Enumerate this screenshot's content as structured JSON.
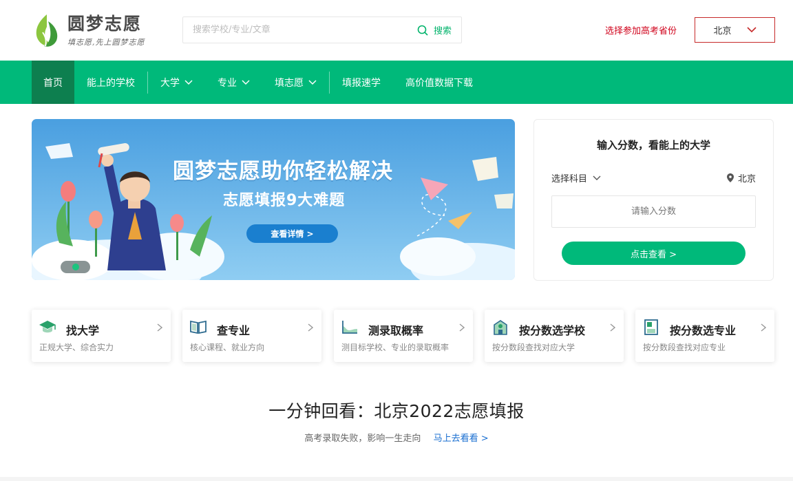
{
  "brand": {
    "name": "圆梦志愿",
    "slogan": "填志愿,先上圆梦志愿"
  },
  "search": {
    "placeholder": "搜索学校/专业/文章",
    "button_label": "搜索"
  },
  "province": {
    "prompt": "选择参加高考省份",
    "selected": "北京"
  },
  "nav": {
    "items": [
      {
        "label": "首页"
      },
      {
        "label": "能上的学校"
      },
      {
        "label": "大学"
      },
      {
        "label": "专业"
      },
      {
        "label": "填志愿"
      },
      {
        "label": "填报速学"
      },
      {
        "label": "高价值数据下载"
      }
    ]
  },
  "banner": {
    "title": "圆梦志愿助你轻松解决",
    "subtitle": "志愿填报9大难题",
    "button_label": "查看详情 >"
  },
  "score_box": {
    "title": "输入分数，看能上的大学",
    "subject_label": "选择科目",
    "location": "北京",
    "input_placeholder": "请输入分数",
    "button_label": "点击查看 >"
  },
  "features": [
    {
      "title": "找大学",
      "desc": "正规大学、综合实力",
      "icon": "graduation-cap-icon"
    },
    {
      "title": "查专业",
      "desc": "核心课程、就业方向",
      "icon": "open-book-icon"
    },
    {
      "title": "测录取概率",
      "desc": "测目标学校、专业的录取概率",
      "icon": "area-chart-icon"
    },
    {
      "title": "按分数选学校",
      "desc": "按分数段查找对应大学",
      "icon": "school-building-icon"
    },
    {
      "title": "按分数选专业",
      "desc": "按分数段查找对应专业",
      "icon": "document-list-icon"
    }
  ],
  "section": {
    "title": "一分钟回看：北京2022志愿填报",
    "subtitle": "高考录取失败，影响一生走向",
    "link_label": "马上去看看 >"
  },
  "colors": {
    "brand_green": "#00b97a",
    "nav_active": "#0d7f4f",
    "alert_red": "#d0021b",
    "link_blue": "#1a6fd1"
  }
}
